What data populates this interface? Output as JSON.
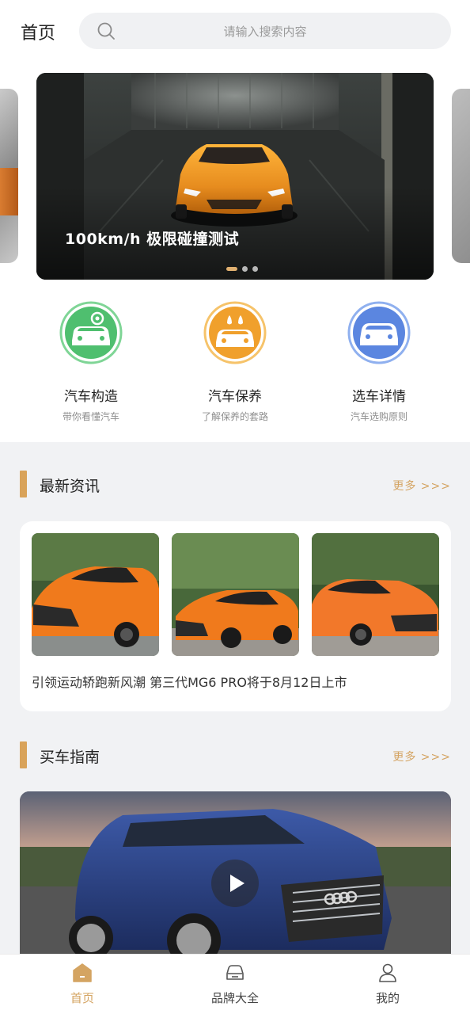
{
  "header": {
    "title": "首页",
    "search_placeholder": "请输入搜索内容"
  },
  "banner": {
    "caption": "100km/h 极限碰撞测试",
    "slide_count": 3,
    "active_index": 0
  },
  "quick_entries": [
    {
      "title": "汽车构造",
      "subtitle": "带你看懂汽车",
      "icon": "car-gear-icon",
      "color": "#4fbf6f"
    },
    {
      "title": "汽车保养",
      "subtitle": "了解保养的套路",
      "icon": "car-wash-icon",
      "color": "#f0a02c"
    },
    {
      "title": "选车详情",
      "subtitle": "汽车选购原则",
      "icon": "car-icon",
      "color": "#5b86e0"
    }
  ],
  "news_section": {
    "title": "最新资讯",
    "more": "更多 >>>",
    "headline": "引领运动轿跑新风潮 第三代MG6 PRO将于8月12日上市"
  },
  "guide_section": {
    "title": "买车指南",
    "more": "更多 >>>"
  },
  "tabbar": [
    {
      "label": "首页",
      "icon": "home-icon",
      "active": true
    },
    {
      "label": "品牌大全",
      "icon": "car-front-icon",
      "active": false
    },
    {
      "label": "我的",
      "icon": "user-icon",
      "active": false
    }
  ],
  "colors": {
    "accent": "#d4a462",
    "background_grey": "#f1f2f4"
  }
}
